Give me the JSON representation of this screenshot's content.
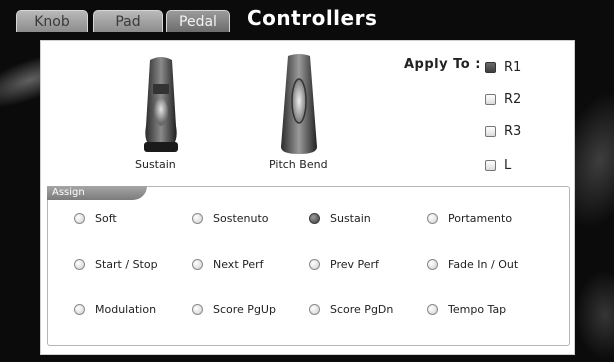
{
  "tabs": [
    {
      "label": "Knob",
      "active": false
    },
    {
      "label": "Pad",
      "active": false
    },
    {
      "label": "Pedal",
      "active": true
    }
  ],
  "title": "Controllers",
  "controllers": [
    {
      "label": "Sustain",
      "icon": "sustain-pedal-icon"
    },
    {
      "label": "Pitch Bend",
      "icon": "pitch-bend-pedal-icon"
    }
  ],
  "apply_to": {
    "label": "Apply To :",
    "options": [
      {
        "label": "R1",
        "checked": true
      },
      {
        "label": "R2",
        "checked": false
      },
      {
        "label": "R3",
        "checked": false
      },
      {
        "label": "L",
        "checked": false
      }
    ]
  },
  "assign": {
    "title": "Assign",
    "options": [
      {
        "label": "Soft",
        "selected": false
      },
      {
        "label": "Sostenuto",
        "selected": false
      },
      {
        "label": "Sustain",
        "selected": true
      },
      {
        "label": "Portamento",
        "selected": false
      },
      {
        "label": "Start / Stop",
        "selected": false
      },
      {
        "label": "Next Perf",
        "selected": false
      },
      {
        "label": "Prev Perf",
        "selected": false
      },
      {
        "label": "Fade In / Out",
        "selected": false
      },
      {
        "label": "Modulation",
        "selected": false
      },
      {
        "label": "Score PgUp",
        "selected": false
      },
      {
        "label": "Score PgDn",
        "selected": false
      },
      {
        "label": "Tempo Tap",
        "selected": false
      }
    ]
  },
  "colors": {
    "background": "#0b0b0b",
    "panel": "#ffffff",
    "selected": "#4a4a4a",
    "tab_active": "#7a7a7a"
  }
}
